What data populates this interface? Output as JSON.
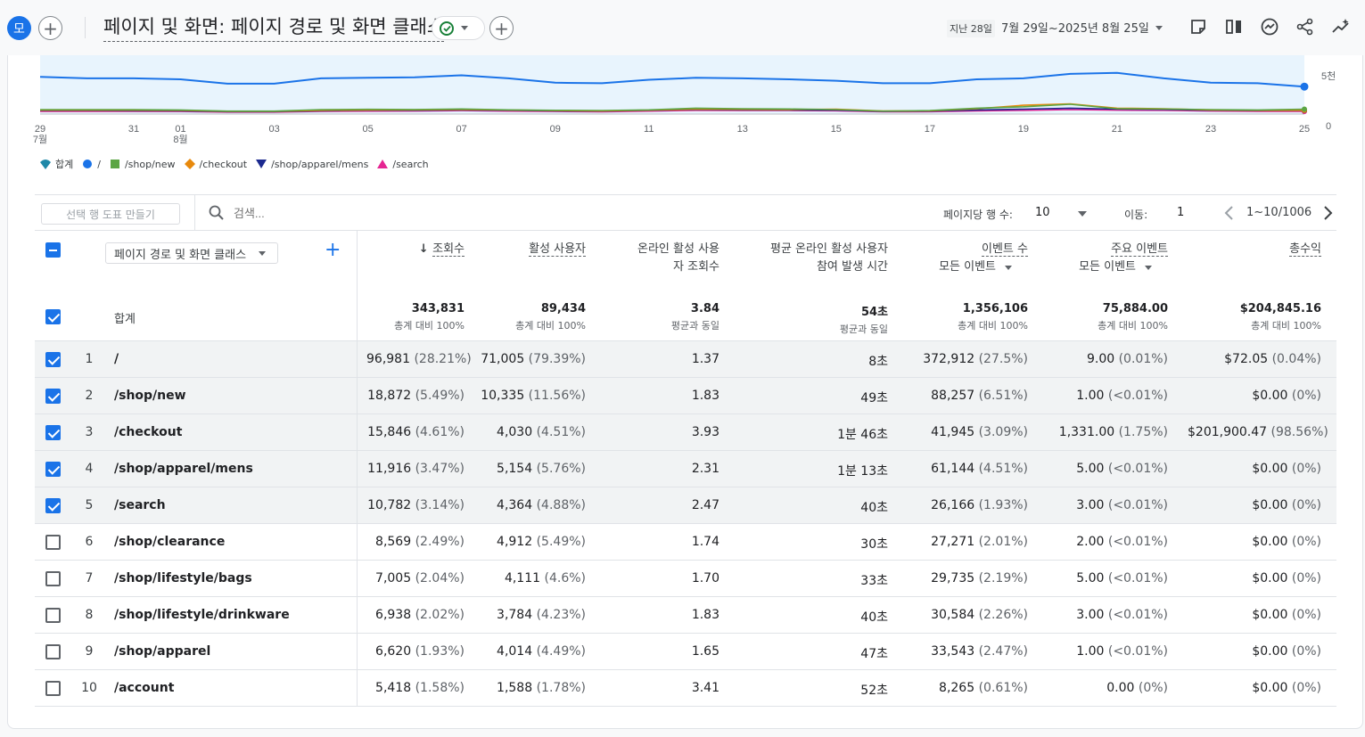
{
  "header": {
    "avatar_letter": "모",
    "title": "페이지 및 화면: 페이지 경로 및 화면 클래스",
    "date_badge": "지난 28일",
    "date_range": "7월 29일~2025년 8월 25일"
  },
  "chart_data": {
    "type": "line",
    "x": [
      "7월 29",
      "7월 30",
      "7월 31",
      "8월 01",
      "8월 02",
      "8월 03",
      "8월 04",
      "8월 05",
      "8월 06",
      "8월 07",
      "8월 08",
      "8월 09",
      "8월 10",
      "8월 11",
      "8월 12",
      "8월 13",
      "8월 14",
      "8월 15",
      "8월 16",
      "8월 17",
      "8월 18",
      "8월 19",
      "8월 20",
      "8월 21",
      "8월 22",
      "8월 23",
      "8월 24",
      "8월 25"
    ],
    "x_tick_labels": [
      {
        "label": "29",
        "sub": "7월"
      },
      {
        "label": "31",
        "sub": ""
      },
      {
        "label": "01",
        "sub": "8월"
      },
      {
        "label": "03",
        "sub": ""
      },
      {
        "label": "05",
        "sub": ""
      },
      {
        "label": "07",
        "sub": ""
      },
      {
        "label": "09",
        "sub": ""
      },
      {
        "label": "11",
        "sub": ""
      },
      {
        "label": "13",
        "sub": ""
      },
      {
        "label": "15",
        "sub": ""
      },
      {
        "label": "17",
        "sub": ""
      },
      {
        "label": "19",
        "sub": ""
      },
      {
        "label": "21",
        "sub": ""
      },
      {
        "label": "23",
        "sub": ""
      },
      {
        "label": "25",
        "sub": ""
      }
    ],
    "y_tick_labels": [
      "5천",
      "0"
    ],
    "ylim": [
      0,
      6000
    ],
    "series": [
      {
        "name": "/",
        "color": "#1a73e8",
        "values": [
          3800,
          3650,
          3650,
          3550,
          3100,
          3100,
          3650,
          3700,
          3750,
          3950,
          3650,
          3200,
          3150,
          3500,
          3700,
          3650,
          3550,
          3400,
          3150,
          3150,
          3550,
          3650,
          4100,
          4200,
          3650,
          3200,
          3150,
          2800
        ]
      },
      {
        "name": "/shop/new",
        "color": "#5ba544",
        "values": [
          450,
          450,
          450,
          420,
          300,
          300,
          450,
          480,
          460,
          520,
          430,
          380,
          360,
          430,
          600,
          550,
          520,
          450,
          300,
          350,
          600,
          750,
          1000,
          550,
          520,
          450,
          420,
          500
        ]
      },
      {
        "name": "/checkout",
        "color": "#e8890c",
        "values": [
          400,
          400,
          400,
          380,
          280,
          280,
          380,
          420,
          430,
          460,
          420,
          350,
          330,
          400,
          500,
          480,
          460,
          500,
          320,
          340,
          550,
          900,
          1050,
          600,
          550,
          420,
          380,
          380
        ]
      },
      {
        "name": "/shop/apparel/mens",
        "color": "#1c2a8f",
        "values": [
          350,
          350,
          340,
          330,
          250,
          250,
          330,
          380,
          380,
          420,
          380,
          320,
          300,
          380,
          460,
          430,
          420,
          400,
          280,
          300,
          420,
          500,
          600,
          500,
          470,
          380,
          350,
          350
        ]
      },
      {
        "name": "/search",
        "color": "#e52592",
        "values": [
          280,
          280,
          270,
          260,
          200,
          200,
          270,
          300,
          310,
          350,
          300,
          260,
          240,
          300,
          380,
          370,
          360,
          340,
          230,
          250,
          330,
          380,
          450,
          400,
          380,
          310,
          280,
          270
        ]
      }
    ],
    "legend": [
      {
        "label": "합계",
        "color": "#1e88a8",
        "shape": "pin"
      },
      {
        "label": "/",
        "color": "#1a73e8",
        "shape": "circle"
      },
      {
        "label": "/shop/new",
        "color": "#5ba544",
        "shape": "square"
      },
      {
        "label": "/checkout",
        "color": "#e8890c",
        "shape": "diamond"
      },
      {
        "label": "/shop/apparel/mens",
        "color": "#1c2a8f",
        "shape": "triangle-down"
      },
      {
        "label": "/search",
        "color": "#e52592",
        "shape": "triangle-up"
      }
    ]
  },
  "toolbar": {
    "select_rows_button": "선택 행 도표 만들기",
    "search_placeholder": "검색...",
    "rows_per_page_label": "페이지당 행 수:",
    "rows_per_page_value": "10",
    "goto_label": "이동:",
    "goto_value": "1",
    "page_range": "1~10/1006"
  },
  "table": {
    "dimension_selector": "페이지 경로 및 화면 클래스",
    "total_label": "합계",
    "columns": [
      {
        "line1": "조회수",
        "line2": "",
        "sort": true,
        "dropdown": false
      },
      {
        "line1": "활성 사용자",
        "line2": "",
        "sort": false,
        "dropdown": false
      },
      {
        "line1": "온라인 활성 사용",
        "line2": "자 조회수",
        "sort": false,
        "dropdown": false
      },
      {
        "line1": "평균 온라인 활성 사용자",
        "line2": "참여 발생 시간",
        "sort": false,
        "dropdown": false
      },
      {
        "line1": "이벤트 수",
        "line2": "모든 이벤트",
        "sort": false,
        "dropdown": true
      },
      {
        "line1": "주요 이벤트",
        "line2": "모든 이벤트",
        "sort": false,
        "dropdown": true
      },
      {
        "line1": "총수익",
        "line2": "",
        "sort": false,
        "dropdown": false
      }
    ],
    "totals": [
      {
        "value": "343,831",
        "sub": "총계 대비 100%"
      },
      {
        "value": "89,434",
        "sub": "총계 대비 100%"
      },
      {
        "value": "3.84",
        "sub": "평균과 동일"
      },
      {
        "value": "54초",
        "sub": "평균과 동일"
      },
      {
        "value": "1,356,106",
        "sub": "총계 대비 100%"
      },
      {
        "value": "75,884.00",
        "sub": "총계 대비 100%"
      },
      {
        "value": "$204,845.16",
        "sub": "총계 대비 100%"
      }
    ],
    "rows": [
      {
        "num": "1",
        "path": "/",
        "checked": true,
        "cells": [
          [
            "96,981",
            "(28.21%)"
          ],
          [
            "71,005",
            "(79.39%)"
          ],
          [
            "1.37",
            ""
          ],
          [
            "8초",
            ""
          ],
          [
            "372,912",
            "(27.5%)"
          ],
          [
            "9.00",
            "(0.01%)"
          ],
          [
            "$72.05",
            "(0.04%)"
          ]
        ]
      },
      {
        "num": "2",
        "path": "/shop/new",
        "checked": true,
        "cells": [
          [
            "18,872",
            "(5.49%)"
          ],
          [
            "10,335",
            "(11.56%)"
          ],
          [
            "1.83",
            ""
          ],
          [
            "49초",
            ""
          ],
          [
            "88,257",
            "(6.51%)"
          ],
          [
            "1.00",
            "(<0.01%)"
          ],
          [
            "$0.00",
            "(0%)"
          ]
        ]
      },
      {
        "num": "3",
        "path": "/checkout",
        "checked": true,
        "cells": [
          [
            "15,846",
            "(4.61%)"
          ],
          [
            "4,030",
            "(4.51%)"
          ],
          [
            "3.93",
            ""
          ],
          [
            "1분 46초",
            ""
          ],
          [
            "41,945",
            "(3.09%)"
          ],
          [
            "1,331.00",
            "(1.75%)"
          ],
          [
            "$201,900.47",
            "(98.56%)"
          ]
        ]
      },
      {
        "num": "4",
        "path": "/shop/apparel/mens",
        "checked": true,
        "cells": [
          [
            "11,916",
            "(3.47%)"
          ],
          [
            "5,154",
            "(5.76%)"
          ],
          [
            "2.31",
            ""
          ],
          [
            "1분 13초",
            ""
          ],
          [
            "61,144",
            "(4.51%)"
          ],
          [
            "5.00",
            "(<0.01%)"
          ],
          [
            "$0.00",
            "(0%)"
          ]
        ]
      },
      {
        "num": "5",
        "path": "/search",
        "checked": true,
        "cells": [
          [
            "10,782",
            "(3.14%)"
          ],
          [
            "4,364",
            "(4.88%)"
          ],
          [
            "2.47",
            ""
          ],
          [
            "40초",
            ""
          ],
          [
            "26,166",
            "(1.93%)"
          ],
          [
            "3.00",
            "(<0.01%)"
          ],
          [
            "$0.00",
            "(0%)"
          ]
        ]
      },
      {
        "num": "6",
        "path": "/shop/clearance",
        "checked": false,
        "cells": [
          [
            "8,569",
            "(2.49%)"
          ],
          [
            "4,912",
            "(5.49%)"
          ],
          [
            "1.74",
            ""
          ],
          [
            "30초",
            ""
          ],
          [
            "27,271",
            "(2.01%)"
          ],
          [
            "2.00",
            "(<0.01%)"
          ],
          [
            "$0.00",
            "(0%)"
          ]
        ]
      },
      {
        "num": "7",
        "path": "/shop/lifestyle/bags",
        "checked": false,
        "cells": [
          [
            "7,005",
            "(2.04%)"
          ],
          [
            "4,111",
            "(4.6%)"
          ],
          [
            "1.70",
            ""
          ],
          [
            "33초",
            ""
          ],
          [
            "29,735",
            "(2.19%)"
          ],
          [
            "5.00",
            "(<0.01%)"
          ],
          [
            "$0.00",
            "(0%)"
          ]
        ]
      },
      {
        "num": "8",
        "path": "/shop/lifestyle/drinkware",
        "checked": false,
        "cells": [
          [
            "6,938",
            "(2.02%)"
          ],
          [
            "3,784",
            "(4.23%)"
          ],
          [
            "1.83",
            ""
          ],
          [
            "40초",
            ""
          ],
          [
            "30,584",
            "(2.26%)"
          ],
          [
            "3.00",
            "(<0.01%)"
          ],
          [
            "$0.00",
            "(0%)"
          ]
        ]
      },
      {
        "num": "9",
        "path": "/shop/apparel",
        "checked": false,
        "cells": [
          [
            "6,620",
            "(1.93%)"
          ],
          [
            "4,014",
            "(4.49%)"
          ],
          [
            "1.65",
            ""
          ],
          [
            "47초",
            ""
          ],
          [
            "33,543",
            "(2.47%)"
          ],
          [
            "1.00",
            "(<0.01%)"
          ],
          [
            "$0.00",
            "(0%)"
          ]
        ]
      },
      {
        "num": "10",
        "path": "/account",
        "checked": false,
        "cells": [
          [
            "5,418",
            "(1.58%)"
          ],
          [
            "1,588",
            "(1.78%)"
          ],
          [
            "3.41",
            ""
          ],
          [
            "52초",
            ""
          ],
          [
            "8,265",
            "(0.61%)"
          ],
          [
            "0.00",
            "(0%)"
          ],
          [
            "$0.00",
            "(0%)"
          ]
        ]
      }
    ]
  }
}
